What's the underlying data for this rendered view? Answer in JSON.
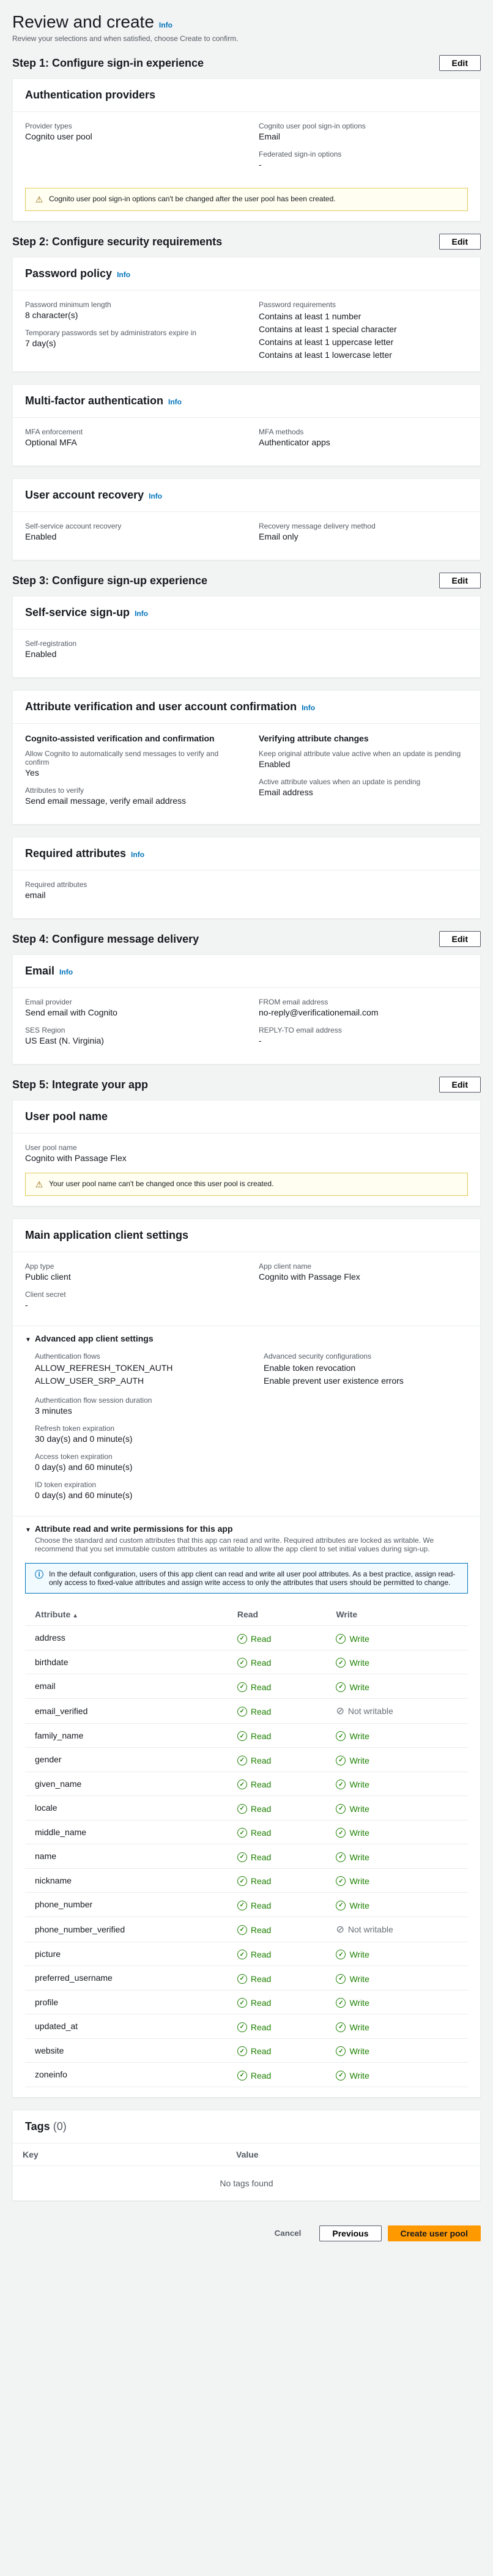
{
  "title": "Review and create",
  "desc": "Review your selections and when satisfied, choose Create to confirm.",
  "editLabel": "Edit",
  "infoLabel": "Info",
  "step1": {
    "title": "Step 1: Configure sign-in experience",
    "p1": {
      "title": "Authentication providers",
      "providerTypesLbl": "Provider types",
      "providerTypesVal": "Cognito user pool",
      "signinOptLbl": "Cognito user pool sign-in options",
      "signinOptVal": "Email",
      "fedLbl": "Federated sign-in options",
      "fedVal": "-",
      "warn": "Cognito user pool sign-in options can't be changed after the user pool has been created."
    }
  },
  "step2": {
    "title": "Step 2: Configure security requirements",
    "pwd": {
      "title": "Password policy",
      "minLbl": "Password minimum length",
      "minVal": "8 character(s)",
      "tmpLbl": "Temporary passwords set by administrators expire in",
      "tmpVal": "7 day(s)",
      "reqLbl": "Password requirements",
      "req1": "Contains at least 1 number",
      "req2": "Contains at least 1 special character",
      "req3": "Contains at least 1 uppercase letter",
      "req4": "Contains at least 1 lowercase letter"
    },
    "mfa": {
      "title": "Multi-factor authentication",
      "enfLbl": "MFA enforcement",
      "enfVal": "Optional MFA",
      "methLbl": "MFA methods",
      "methVal": "Authenticator apps"
    },
    "rec": {
      "title": "User account recovery",
      "ssLbl": "Self-service account recovery",
      "ssVal": "Enabled",
      "delLbl": "Recovery message delivery method",
      "delVal": "Email only"
    }
  },
  "step3": {
    "title": "Step 3: Configure sign-up experience",
    "ss": {
      "title": "Self-service sign-up",
      "regLbl": "Self-registration",
      "regVal": "Enabled"
    },
    "av": {
      "title": "Attribute verification and user account confirmation",
      "c1Title": "Cognito-assisted verification and confirmation",
      "allowLbl": "Allow Cognito to automatically send messages to verify and confirm",
      "allowVal": "Yes",
      "attrLbl": "Attributes to verify",
      "attrVal": "Send email message, verify email address",
      "c2Title": "Verifying attribute changes",
      "keepLbl": "Keep original attribute value active when an update is pending",
      "keepVal": "Enabled",
      "activeLbl": "Active attribute values when an update is pending",
      "activeVal": "Email address"
    },
    "req": {
      "title": "Required attributes",
      "lbl": "Required attributes",
      "val": "email"
    }
  },
  "step4": {
    "title": "Step 4: Configure message delivery",
    "email": {
      "title": "Email",
      "provLbl": "Email provider",
      "provVal": "Send email with Cognito",
      "sesLbl": "SES Region",
      "sesVal": "US East (N. Virginia)",
      "fromLbl": "FROM email address",
      "fromVal": "no-reply@verificationemail.com",
      "replyLbl": "REPLY-TO email address",
      "replyVal": "-"
    }
  },
  "step5": {
    "title": "Step 5: Integrate your app",
    "pool": {
      "title": "User pool name",
      "nameLbl": "User pool name",
      "nameVal": "Cognito with Passage Flex",
      "warn": "Your user pool name can't be changed once this user pool is created."
    },
    "main": {
      "title": "Main application client settings",
      "typeLbl": "App type",
      "typeVal": "Public client",
      "clientLbl": "App client name",
      "clientVal": "Cognito with Passage Flex",
      "secretLbl": "Client secret",
      "secretVal": "-"
    },
    "adv": {
      "title": "Advanced app client settings",
      "flowLbl": "Authentication flows",
      "flow1": "ALLOW_REFRESH_TOKEN_AUTH",
      "flow2": "ALLOW_USER_SRP_AUTH",
      "sessLbl": "Authentication flow session duration",
      "sessVal": "3 minutes",
      "refLbl": "Refresh token expiration",
      "refVal": "30 day(s) and 0 minute(s)",
      "accLbl": "Access token expiration",
      "accVal": "0 day(s) and 60 minute(s)",
      "idLbl": "ID token expiration",
      "idVal": "0 day(s) and 60 minute(s)",
      "secLbl": "Advanced security configurations",
      "sec1": "Enable token revocation",
      "sec2": "Enable prevent user existence errors"
    },
    "perm": {
      "title": "Attribute read and write permissions for this app",
      "desc": "Choose the standard and custom attributes that this app can read and write. Required attributes are locked as writable. We recommend that you set immutable custom attributes as writable to allow the app client to set initial values during sign-up.",
      "info": "In the default configuration, users of this app client can read and write all user pool attributes. As a best practice, assign read-only access to fixed-value attributes and assign write access to only the attributes that users should be permitted to change.",
      "hAttr": "Attribute",
      "hRead": "Read",
      "hWrite": "Write",
      "readLbl": "Read",
      "writeLbl": "Write",
      "nwLbl": "Not writable",
      "rows": [
        {
          "a": "address",
          "r": true,
          "w": true
        },
        {
          "a": "birthdate",
          "r": true,
          "w": true
        },
        {
          "a": "email",
          "r": true,
          "w": true
        },
        {
          "a": "email_verified",
          "r": true,
          "w": false
        },
        {
          "a": "family_name",
          "r": true,
          "w": true
        },
        {
          "a": "gender",
          "r": true,
          "w": true
        },
        {
          "a": "given_name",
          "r": true,
          "w": true
        },
        {
          "a": "locale",
          "r": true,
          "w": true
        },
        {
          "a": "middle_name",
          "r": true,
          "w": true
        },
        {
          "a": "name",
          "r": true,
          "w": true
        },
        {
          "a": "nickname",
          "r": true,
          "w": true
        },
        {
          "a": "phone_number",
          "r": true,
          "w": true
        },
        {
          "a": "phone_number_verified",
          "r": true,
          "w": false
        },
        {
          "a": "picture",
          "r": true,
          "w": true
        },
        {
          "a": "preferred_username",
          "r": true,
          "w": true
        },
        {
          "a": "profile",
          "r": true,
          "w": true
        },
        {
          "a": "updated_at",
          "r": true,
          "w": true
        },
        {
          "a": "website",
          "r": true,
          "w": true
        },
        {
          "a": "zoneinfo",
          "r": true,
          "w": true
        }
      ]
    },
    "tags": {
      "title": "Tags",
      "count": "(0)",
      "key": "Key",
      "value": "Value",
      "empty": "No tags found"
    }
  },
  "footer": {
    "cancel": "Cancel",
    "prev": "Previous",
    "create": "Create user pool"
  }
}
